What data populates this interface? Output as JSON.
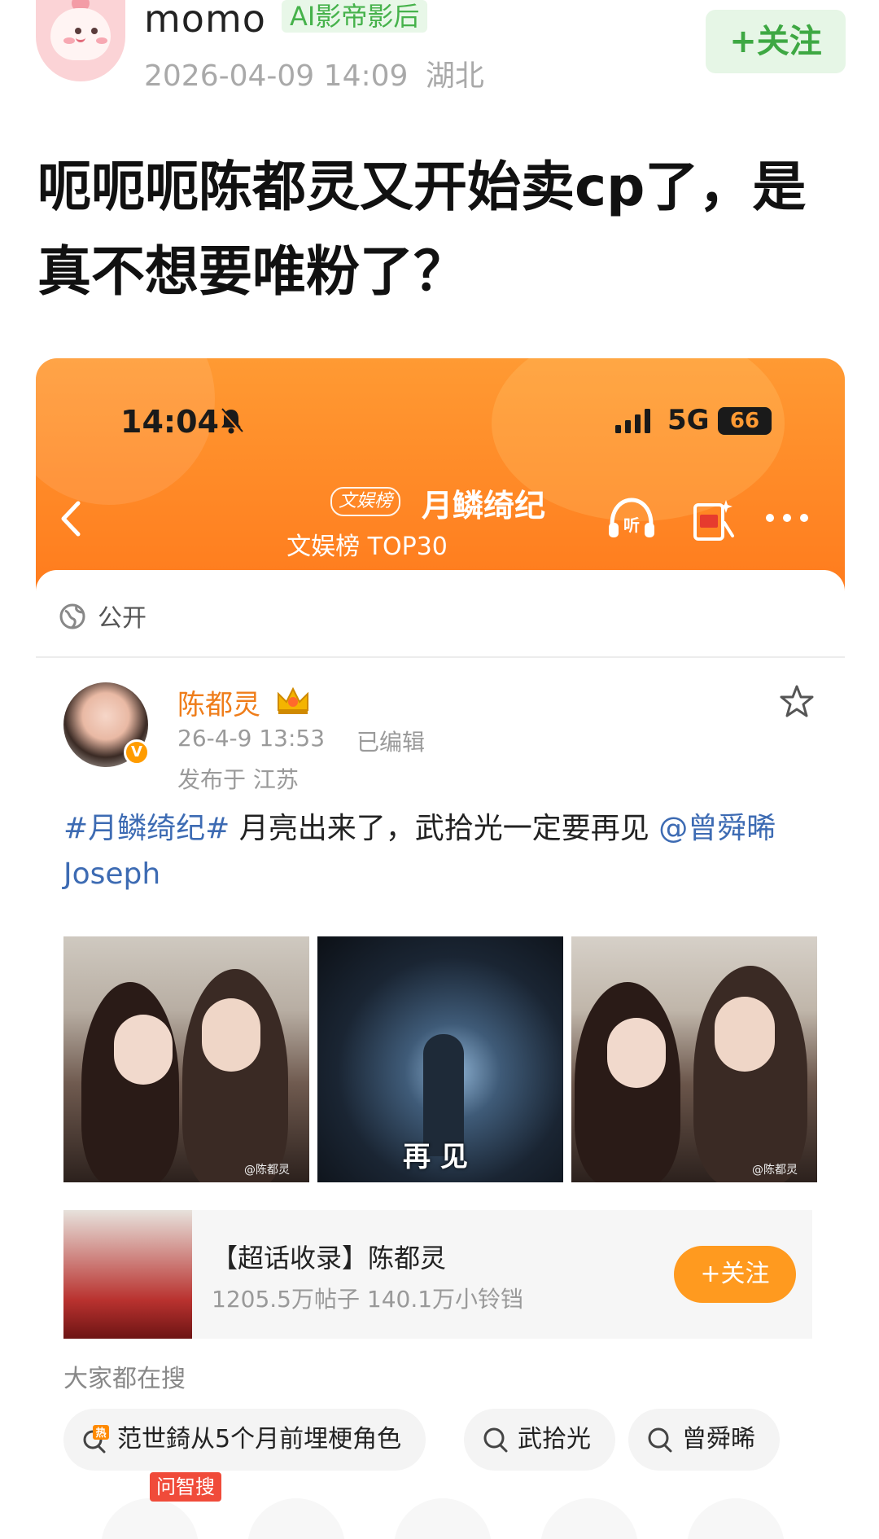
{
  "poster": {
    "name": "momo",
    "badge": "AI影帝影后",
    "date": "2026-04-09 14:09",
    "location": "湖北",
    "follow_label": "+关注"
  },
  "post": {
    "title": "呃呃呃陈都灵又开始卖cp了，是真不想要唯粉了？"
  },
  "screenshot": {
    "status_bar": {
      "time": "14:04",
      "network": "5G",
      "battery": "66"
    },
    "header": {
      "channel_tag": "文娱榜",
      "topic": "月鳞绮纪",
      "rank": "文娱榜 TOP30",
      "listen_label": "听"
    },
    "visibility": "公开",
    "author": {
      "name": "陈都灵",
      "verify_mark": "V",
      "time": "26-4-9 13:53",
      "edited": "已编辑",
      "location": "发布于 江苏"
    },
    "body": {
      "hashtag": "#月鳞绮纪#",
      "text": " 月亮出来了，武拾光一定要再见 ",
      "mention": "@曾舜晞 Joseph"
    },
    "images": [
      {
        "watermark": "@陈都灵"
      },
      {
        "caption": "再见"
      },
      {
        "watermark": "@陈都灵"
      }
    ],
    "super_topic": {
      "title": "【超话收录】陈都灵",
      "stats": "1205.5万帖子 140.1万小铃铛",
      "follow_label": "+关注"
    },
    "search": {
      "label": "大家都在搜",
      "chips": [
        {
          "text": "范世錡从5个月前埋梗角色",
          "icon": "hot-search-icon",
          "hot": "热"
        },
        {
          "text": "武拾光",
          "icon": "search-icon"
        },
        {
          "text": "曾舜晞",
          "icon": "search-icon"
        }
      ],
      "ask_tag": "问智搜"
    }
  },
  "colors": {
    "orange": "#ff7a1c",
    "follow_green": "#3ea843",
    "link_blue": "#3d6bb3",
    "author_orange": "#ef7d1a"
  }
}
